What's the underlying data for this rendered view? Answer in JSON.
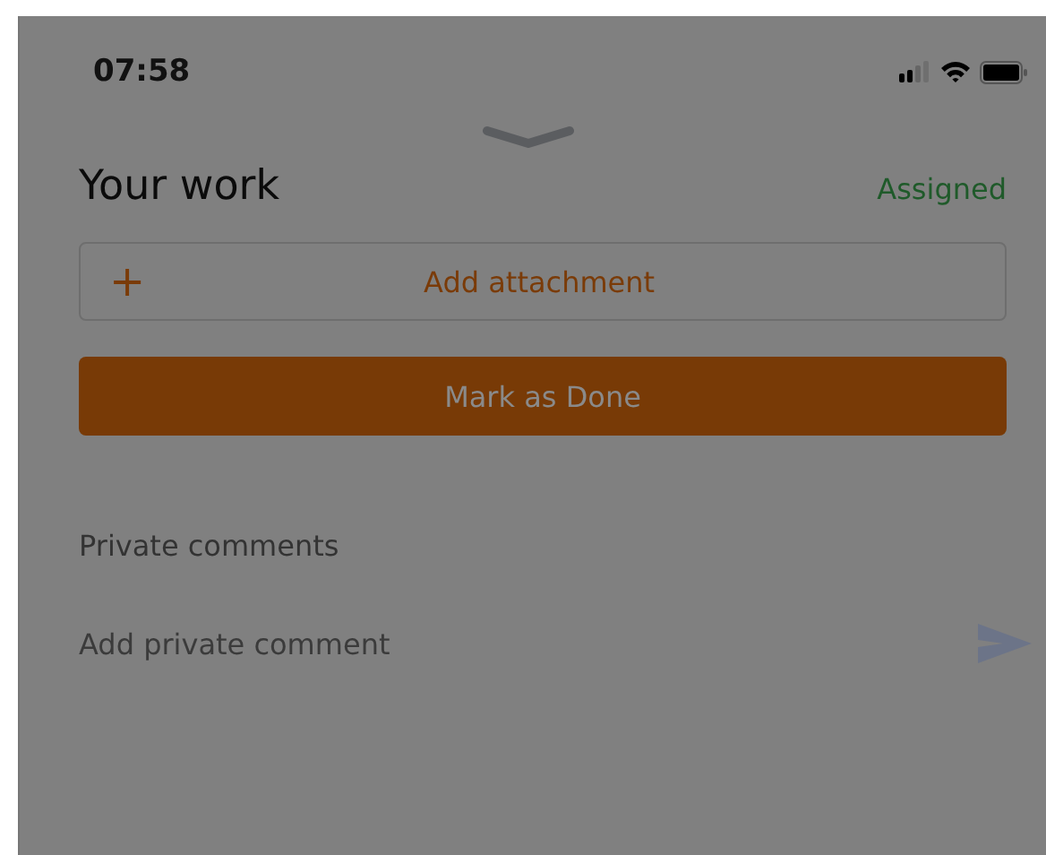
{
  "status_bar": {
    "time": "07:58"
  },
  "header": {
    "title": "Your work",
    "status": "Assigned"
  },
  "attachment_button": {
    "icon": "+",
    "label": "Add attachment"
  },
  "done_button": {
    "label": "Mark as Done"
  },
  "private_comments": {
    "heading": "Private comments",
    "placeholder": "Add private comment"
  }
}
